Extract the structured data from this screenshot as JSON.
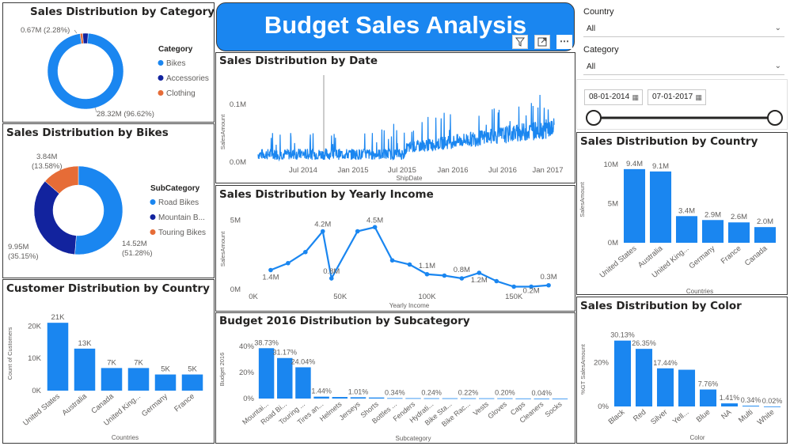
{
  "banner": {
    "title": "Budget Sales Analysis",
    "icons": [
      "filter-icon",
      "focus-mode-icon",
      "more-options-icon"
    ],
    "more_label": "⋯"
  },
  "category_donut": {
    "title": "Sales Distribution by Category",
    "legend_title": "Category",
    "legend": [
      {
        "label": "Bikes",
        "color": "#1a86f0"
      },
      {
        "label": "Accessories",
        "color": "#12239e"
      },
      {
        "label": "Clothing",
        "color": "#e66c37"
      }
    ],
    "labels": {
      "small": "0.67M (2.28%)",
      "big": "28.32M (96.62%)"
    },
    "chart_data": {
      "type": "pie",
      "categories": [
        "Bikes",
        "Accessories",
        "Clothing"
      ],
      "values": [
        28.32,
        0.67,
        0.32
      ],
      "percent": [
        96.62,
        2.28,
        1.1
      ],
      "unit": "M"
    }
  },
  "bikes_donut": {
    "title": "Sales Distribution by Bikes",
    "legend_title": "SubCategory",
    "legend": [
      {
        "label": "Road Bikes",
        "color": "#1a86f0"
      },
      {
        "label": "Mountain B...",
        "color": "#12239e"
      },
      {
        "label": "Touring Bikes",
        "color": "#e66c37"
      }
    ],
    "labels": {
      "touring_val": "3.84M",
      "touring_pct": "(13.58%)",
      "mountain_val": "9.95M",
      "mountain_pct": "(35.15%)",
      "road_val": "14.52M",
      "road_pct": "(51.28%)"
    },
    "chart_data": {
      "type": "pie",
      "categories": [
        "Road Bikes",
        "Mountain Bikes",
        "Touring Bikes"
      ],
      "values": [
        14.52,
        9.95,
        3.84
      ],
      "percent": [
        51.28,
        35.15,
        13.58
      ],
      "unit": "M"
    }
  },
  "customer_bar": {
    "title": "Customer Distribution by Country",
    "xlabel": "Countries",
    "ylabel": "Count of Customers",
    "yticks": [
      "0K",
      "10K",
      "20K"
    ],
    "chart_data": {
      "type": "bar",
      "categories": [
        "United States",
        "Australia",
        "Canada",
        "United King...",
        "Germany",
        "France"
      ],
      "values": [
        21,
        13,
        7,
        7,
        5,
        5
      ],
      "value_labels": [
        "21K",
        "13K",
        "7K",
        "7K",
        "5K",
        "5K"
      ],
      "ylim": [
        0,
        23
      ],
      "unit": "K"
    }
  },
  "date_line": {
    "title": "Sales Distribution by Date",
    "xlabel": "ShipDate",
    "ylabel": "SalesAmount",
    "yticks": [
      "0.0M",
      "0.1M"
    ],
    "xticks": [
      "Jul 2014",
      "Jan 2015",
      "Jul 2015",
      "Jan 2016",
      "Jul 2016",
      "Jan 2017"
    ],
    "chart_data": {
      "type": "line",
      "x_range": [
        "2014-01",
        "2017-01"
      ],
      "ylim": [
        0,
        0.125
      ],
      "series": [
        {
          "values": []
        }
      ]
    }
  },
  "income_line": {
    "title": "Sales Distribution by Yearly Income",
    "xlabel": "Yearly Income",
    "ylabel": "SalesAmount",
    "yticks": [
      "0M",
      "5M"
    ],
    "xticks": [
      "0K",
      "50K",
      "100K",
      "150K"
    ],
    "point_labels": [
      "1.4M",
      "4.2M",
      "0.8M",
      "4.5M",
      "1.1M",
      "0.8M",
      "1.2M",
      "0.3M",
      "0.2M"
    ],
    "chart_data": {
      "type": "line",
      "x": [
        10,
        20,
        30,
        40,
        45,
        60,
        70,
        80,
        90,
        100,
        110,
        120,
        130,
        140,
        150,
        160,
        170
      ],
      "values": [
        1.4,
        1.9,
        2.7,
        4.2,
        0.8,
        4.2,
        4.5,
        2.1,
        1.8,
        1.1,
        1.0,
        0.8,
        1.2,
        0.6,
        0.2,
        0.2,
        0.3
      ],
      "xlim": [
        0,
        180
      ],
      "ylim": [
        0,
        6
      ],
      "unit": "M"
    }
  },
  "budget_bar": {
    "title": "Budget 2016 Distribution by Subcategory",
    "xlabel": "Subcategory",
    "ylabel": "Budget 2016",
    "yticks": [
      "0%",
      "20%",
      "40%"
    ],
    "chart_data": {
      "type": "bar",
      "categories": [
        "Mountai...",
        "Road Bi...",
        "Touring ...",
        "Tires an...",
        "Helmets",
        "Jerseys",
        "Shorts",
        "Bottles ...",
        "Fenders",
        "Hydrati...",
        "Bike Sta...",
        "Bike Rac...",
        "Vests",
        "Gloves",
        "Caps",
        "Cleaners",
        "Socks"
      ],
      "values": [
        38.73,
        31.17,
        24.04,
        1.44,
        1.2,
        1.01,
        0.8,
        0.34,
        0.3,
        0.24,
        0.23,
        0.22,
        0.21,
        0.2,
        0.1,
        0.04,
        0.03
      ],
      "value_labels": [
        "38.73%",
        "31.17%",
        "24.04%",
        "1.44%",
        "",
        "1.01%",
        "",
        "0.34%",
        "",
        "0.24%",
        "",
        "0.22%",
        "",
        "0.20%",
        "",
        "0.04%",
        ""
      ],
      "ylim": [
        0,
        45
      ],
      "unit": "%"
    }
  },
  "filters": {
    "country": {
      "title": "Country",
      "value": "All"
    },
    "category": {
      "title": "Category",
      "value": "All"
    },
    "date_from": "08-01-2014",
    "date_to": "07-01-2017"
  },
  "country_bar": {
    "title": "Sales Distribution by Country",
    "xlabel": "Countries",
    "ylabel": "SalesAmount",
    "yticks": [
      "0M",
      "5M",
      "10M"
    ],
    "chart_data": {
      "type": "bar",
      "categories": [
        "United States",
        "Australia",
        "United King...",
        "Germany",
        "France",
        "Canada"
      ],
      "values": [
        9.4,
        9.1,
        3.4,
        2.9,
        2.6,
        2.0
      ],
      "value_labels": [
        "9.4M",
        "9.1M",
        "3.4M",
        "2.9M",
        "2.6M",
        "2.0M"
      ],
      "ylim": [
        0,
        11
      ],
      "unit": "M"
    }
  },
  "color_bar": {
    "title": "Sales Distribution by Color",
    "xlabel": "Color",
    "ylabel": "%GT SalesAmount",
    "yticks": [
      "0%",
      "20%"
    ],
    "chart_data": {
      "type": "bar",
      "categories": [
        "Black",
        "Red",
        "Silver",
        "Yell...",
        "Blue",
        "NA",
        "Multi",
        "White"
      ],
      "values": [
        30.13,
        26.35,
        17.44,
        16.8,
        7.76,
        1.41,
        0.34,
        0.02
      ],
      "value_labels": [
        "30.13%",
        "26.35%",
        "17.44%",
        "",
        "7.76%",
        "1.41%",
        "0.34%",
        "0.02%"
      ],
      "ylim": [
        0,
        34
      ],
      "unit": "%"
    }
  },
  "colors": {
    "blue": "#1a86f0",
    "navy": "#12239e",
    "orange": "#e66c37",
    "grid": "#e6e6e6",
    "axis_text": "#605e5c"
  }
}
